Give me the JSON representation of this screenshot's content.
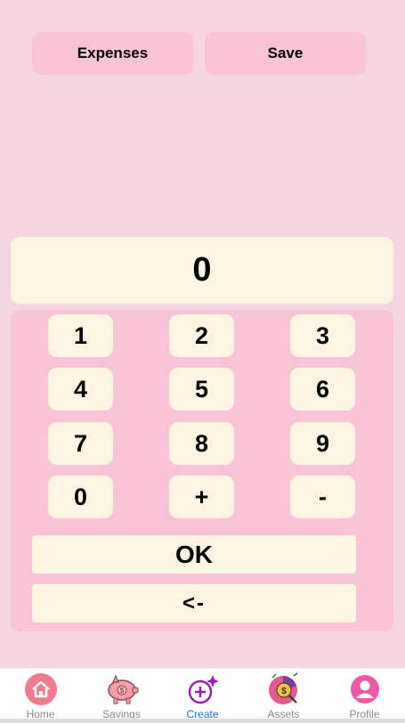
{
  "top_buttons": {
    "expenses_label": "Expenses",
    "save_label": "Save"
  },
  "display": {
    "value": "0"
  },
  "keypad": {
    "keys": [
      "1",
      "2",
      "3",
      "4",
      "5",
      "6",
      "7",
      "8",
      "9",
      "0",
      "+",
      "-"
    ],
    "ok_label": "OK",
    "back_label": "<-"
  },
  "nav": {
    "items": [
      {
        "label": "Home",
        "icon": "home-icon"
      },
      {
        "label": "Savings",
        "icon": "piggy-bank-icon"
      },
      {
        "label": "Create",
        "icon": "add-sparkle-icon",
        "active": true
      },
      {
        "label": "Assets",
        "icon": "coin-chart-icon"
      },
      {
        "label": "Profile",
        "icon": "user-avatar-icon"
      }
    ]
  },
  "colors": {
    "background": "#f6d5e3",
    "button_pink": "#f8c3d7",
    "key_cream": "#fdf5e1",
    "active_nav": "#1e6fd0"
  }
}
